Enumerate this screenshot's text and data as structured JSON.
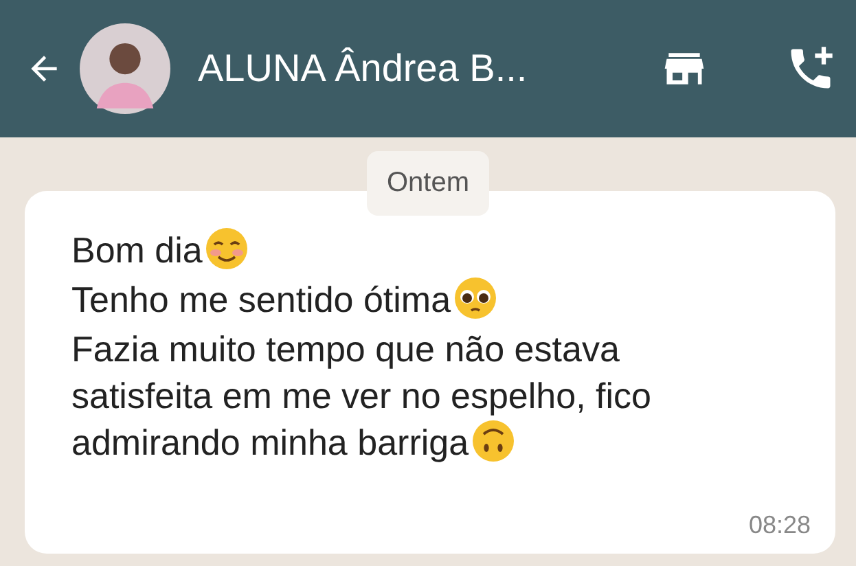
{
  "header": {
    "title": "ALUNA Ândrea B..."
  },
  "date_chip": {
    "label": "Ontem"
  },
  "message": {
    "lines": [
      {
        "text": "Bom dia",
        "kind": "blush"
      },
      {
        "text": "Tenho me sentido ótima",
        "kind": "pleading"
      },
      {
        "text": "Fazia muito tempo que não estava satisfeita em me ver no espelho, fico admirando minha barriga",
        "kind": "upside-down"
      }
    ],
    "time": "08:28"
  }
}
